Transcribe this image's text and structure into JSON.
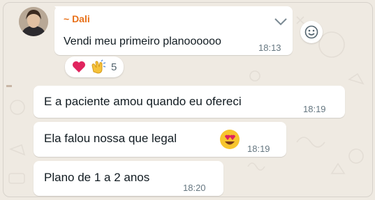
{
  "colors": {
    "background": "#efeae2",
    "bubble": "#ffffff",
    "sender_name": "#e8711a",
    "timestamp": "#667781",
    "text": "#111b21"
  },
  "messages": [
    {
      "sender": "~ Dali",
      "text": "Vendi meu primeiro planoooooo",
      "time": "18:13",
      "reactions": {
        "emojis": [
          "red-heart",
          "clapping-hands"
        ],
        "count": "5"
      }
    },
    {
      "text": "E a paciente amou quando eu ofereci",
      "time": "18:19"
    },
    {
      "text": "Ela falou nossa que legal",
      "emoji": "heart-eyes-face",
      "time": "18:19"
    },
    {
      "text": "Plano de 1 a 2 anos",
      "time": "18:20"
    }
  ],
  "icons": {
    "menu_chevron": "chevron-down-icon",
    "react_button": "smiley-icon"
  }
}
